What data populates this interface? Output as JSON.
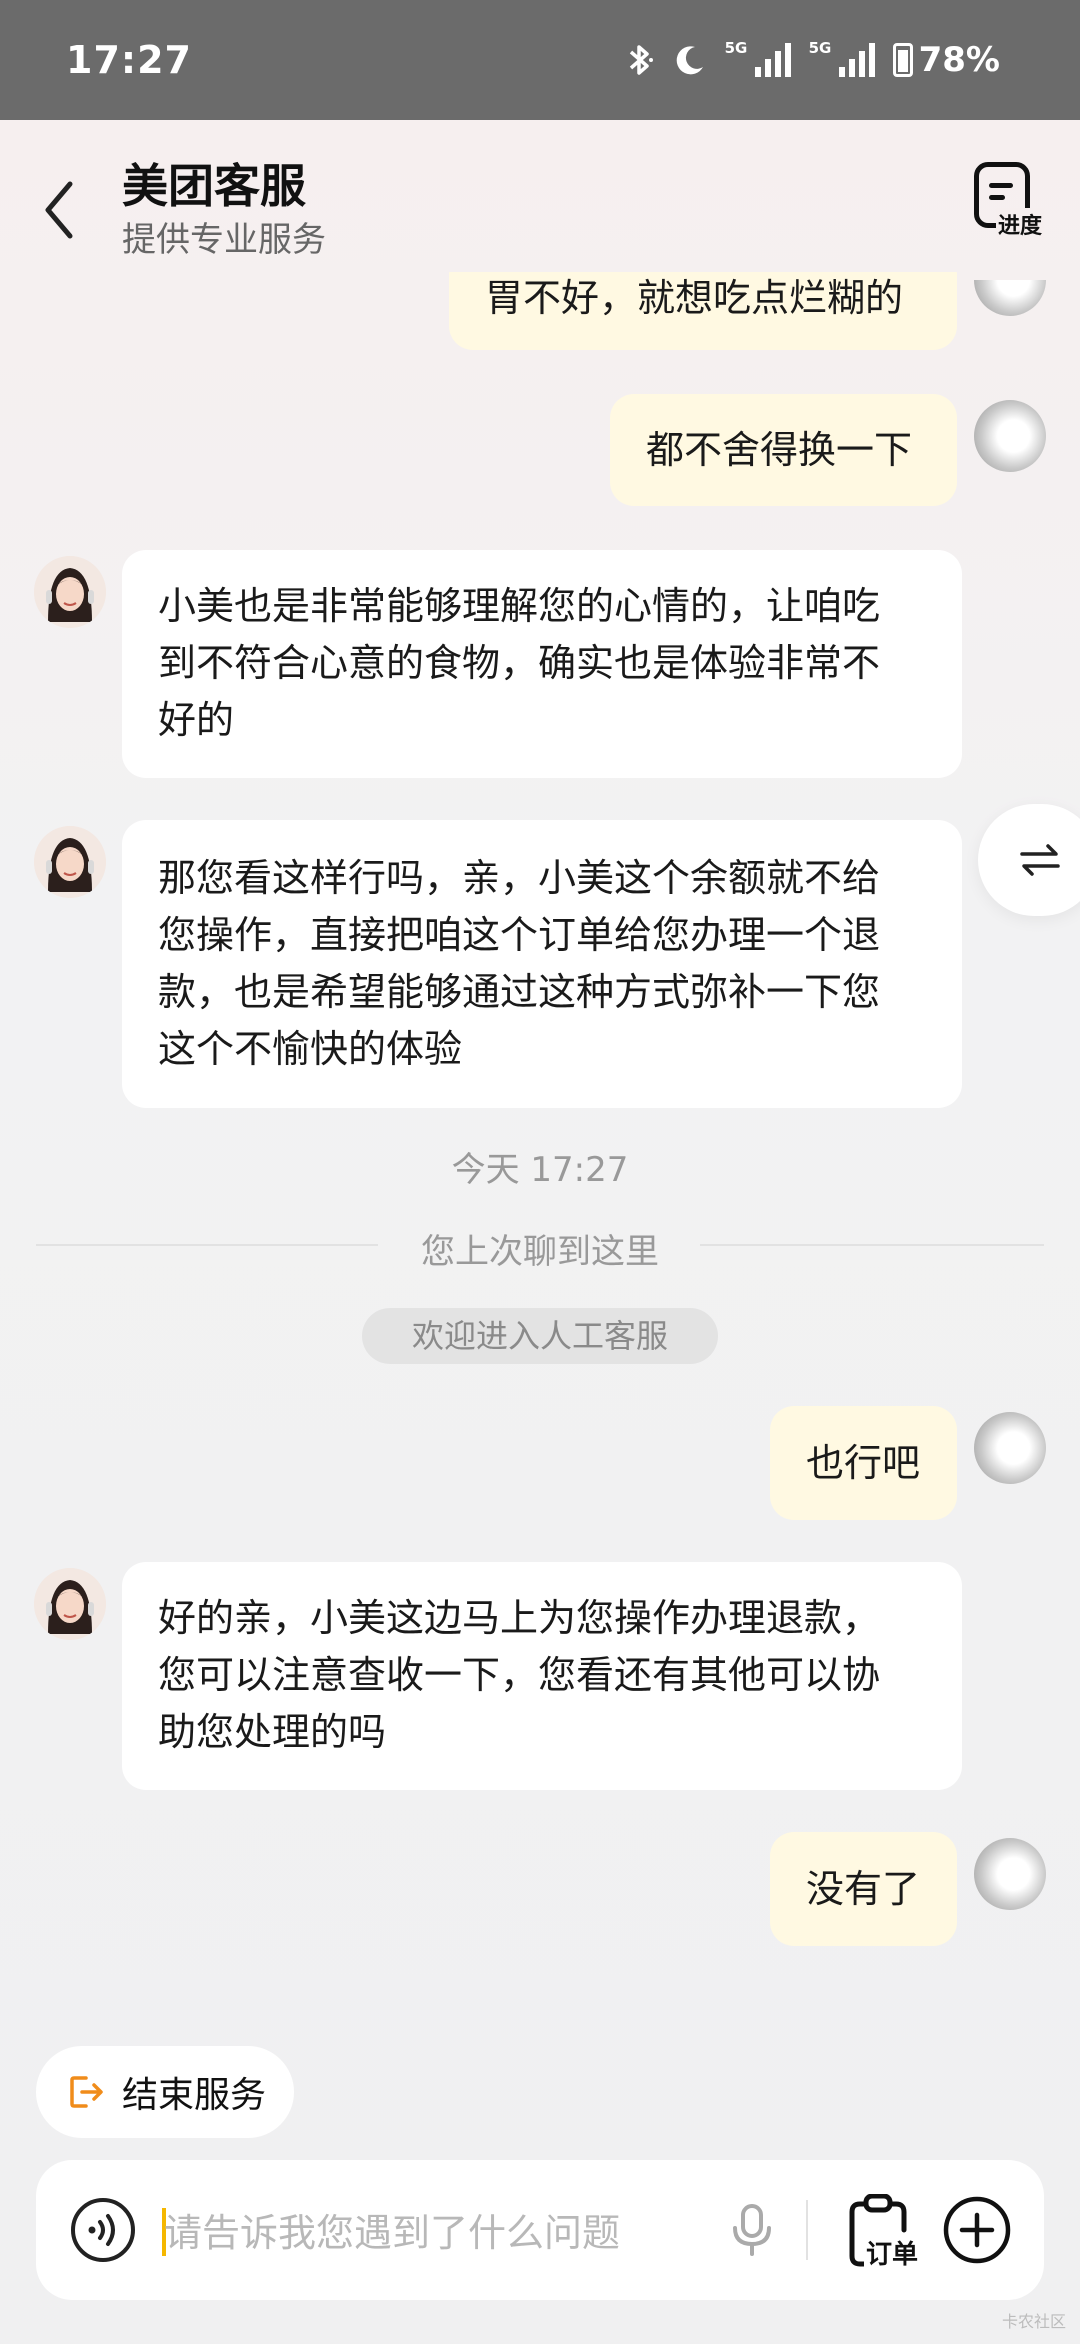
{
  "status_bar": {
    "time": "17:27",
    "battery": "78%",
    "signal_tag": "5G"
  },
  "header": {
    "title": "美团客服",
    "subtitle": "提供专业服务",
    "progress_label": "进度"
  },
  "messages": {
    "m0": "胃不好，就想吃点烂糊的",
    "m1": "都不舍得换一下",
    "m2_l1": "小美也是非常能够理解您的心情的，让咱吃",
    "m2_l2": "到不符合心意的食物，确实也是体验非常不",
    "m2_l3": "好的",
    "m3_l1": "那您看这样行吗，亲，小美这个余额就不给",
    "m3_l2": "您操作，直接把咱这个订单给您办理一个退",
    "m3_l3": "款，也是希望能够通过这种方式弥补一下您",
    "m3_l4": "这个不愉快的体验",
    "m4": "也行吧",
    "m5_l1": "好的亲，小美这边马上为您操作办理退款，",
    "m5_l2": "您可以注意查收一下，您看还有其他可以协",
    "m5_l3": "助您处理的吗",
    "m6": "没有了"
  },
  "timestamp": "今天 17:27",
  "divider_text": "您上次聊到这里",
  "system_notice": "欢迎进入人工客服",
  "end_service_label": "结束服务",
  "input": {
    "placeholder": "请告诉我您遇到了什么问题",
    "order_label": "订单"
  },
  "watermark": "卡农社区",
  "colors": {
    "user_bubble": "#fff9e2",
    "agent_bubble": "#ffffff",
    "accent_orange": "#f08c1a"
  }
}
